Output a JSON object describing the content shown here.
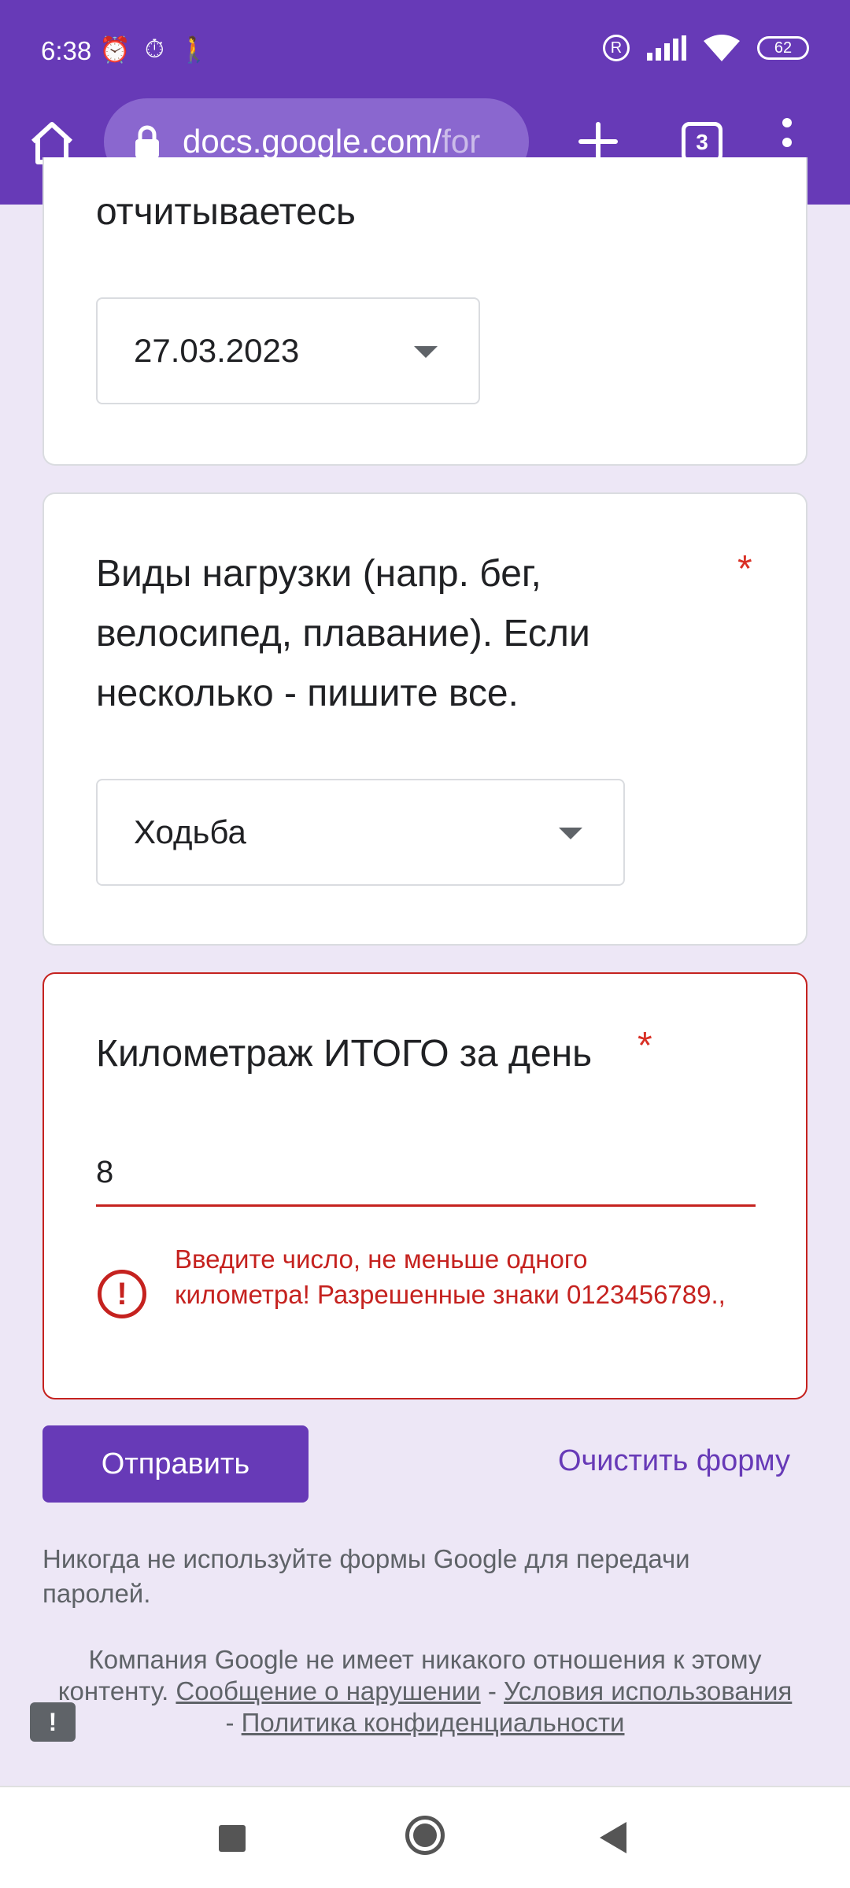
{
  "status_bar": {
    "time": "6:38",
    "battery": "62",
    "icons": [
      "alarm-icon",
      "clock-icon",
      "walk-icon",
      "r-badge-icon",
      "signal-icon",
      "wifi-icon",
      "battery-icon"
    ]
  },
  "browser": {
    "url_main": "docs.google.com/",
    "url_dim": "for",
    "tab_count": "3"
  },
  "questions": {
    "q1_title_tail": "отчитываетесь",
    "q1_value": "27.03.2023",
    "q2_title": "Виды нагрузки (напр. бег, велосипед, плавание). Если несколько - пишите все.",
    "q2_value": "Ходьба",
    "q3_title": "Километраж ИТОГО за день",
    "q3_value": "8",
    "required_mark": "*",
    "error_text": "Введите число, не меньше одного километра! Разрешенные знаки 0123456789.,"
  },
  "actions": {
    "submit_label": "Отправить",
    "clear_label": "Очистить форму"
  },
  "footer": {
    "warning": "Никогда не используйте формы Google для передачи паролей.",
    "disclaimer": "Компания Google не имеет никакого отношения к этому контенту.",
    "report_link": "Сообщение о нарушении",
    "sep1": " - ",
    "terms_link": "Условия использования",
    "sep2": " - ",
    "privacy_link": "Политика конфиденциальности"
  },
  "colors": {
    "brand": "#673ab7",
    "error": "#c5221f",
    "background": "#ede7f6"
  }
}
